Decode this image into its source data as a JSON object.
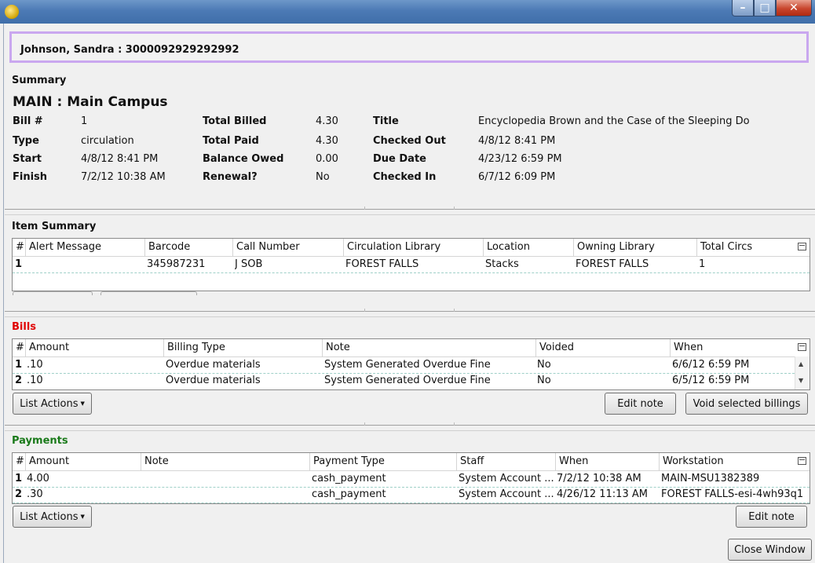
{
  "window": {
    "min_icon": "minimize-icon",
    "max_icon": "maximize-icon",
    "close_icon": "close-icon"
  },
  "patient_header": "Johnson, Sandra  : 3000092929292992",
  "summary": {
    "section_title": "Summary",
    "location": "MAIN : Main Campus",
    "fields": {
      "bill_label": "Bill #",
      "bill_value": "1",
      "type_label": "Type",
      "type_value": "circulation",
      "start_label": "Start",
      "start_value": "4/8/12 8:41 PM",
      "finish_label": "Finish",
      "finish_value": "7/2/12 10:38 AM",
      "total_billed_label": "Total Billed",
      "total_billed_value": "4.30",
      "total_paid_label": "Total Paid",
      "total_paid_value": "4.30",
      "balance_owed_label": "Balance Owed",
      "balance_owed_value": "0.00",
      "renewal_label": "Renewal?",
      "renewal_value": "No",
      "title_label": "Title",
      "title_value": "Encyclopedia Brown and the Case of the Sleeping Do",
      "checked_out_label": "Checked Out",
      "checked_out_value": "4/8/12 8:41 PM",
      "due_date_label": "Due Date",
      "due_date_value": "4/23/12 6:59 PM",
      "checked_in_label": "Checked In",
      "checked_in_value": "6/7/12 6:09 PM"
    }
  },
  "item_summary": {
    "section_title": "Item Summary",
    "columns": [
      "#",
      "Alert Message",
      "Barcode",
      "Call Number",
      "Circulation Library",
      "Location",
      "Owning Library",
      "Total Circs"
    ],
    "rows": [
      [
        "1",
        "",
        "345987231",
        "J SOB",
        "FOREST FALLS",
        "Stacks",
        "FOREST FALLS",
        "1"
      ]
    ]
  },
  "bills": {
    "section_title": "Bills",
    "title_color": "#e00000",
    "columns": [
      "#",
      "Amount",
      "Billing Type",
      "Note",
      "Voided",
      "When"
    ],
    "rows": [
      [
        "1",
        ".10",
        "Overdue materials",
        "System Generated Overdue Fine",
        "No",
        "6/6/12 6:59 PM"
      ],
      [
        "2",
        ".10",
        "Overdue materials",
        "System Generated Overdue Fine",
        "No",
        "6/5/12 6:59 PM"
      ]
    ],
    "list_actions": "List Actions",
    "edit_note": "Edit note",
    "void_selected": "Void selected billings"
  },
  "payments": {
    "section_title": "Payments",
    "title_color": "#1a7a1a",
    "columns": [
      "#",
      "Amount",
      "Note",
      "Payment Type",
      "Staff",
      "When",
      "Workstation"
    ],
    "rows": [
      [
        "1",
        "4.00",
        "",
        "cash_payment",
        "System Account ...",
        "7/2/12 10:38 AM",
        "MAIN-MSU1382389"
      ],
      [
        "2",
        ".30",
        "",
        "cash_payment",
        "System Account ...",
        "4/26/12 11:13 AM",
        "FOREST FALLS-esi-4wh93q1"
      ]
    ],
    "list_actions": "List Actions",
    "edit_note": "Edit note"
  },
  "close_window": "Close Window"
}
